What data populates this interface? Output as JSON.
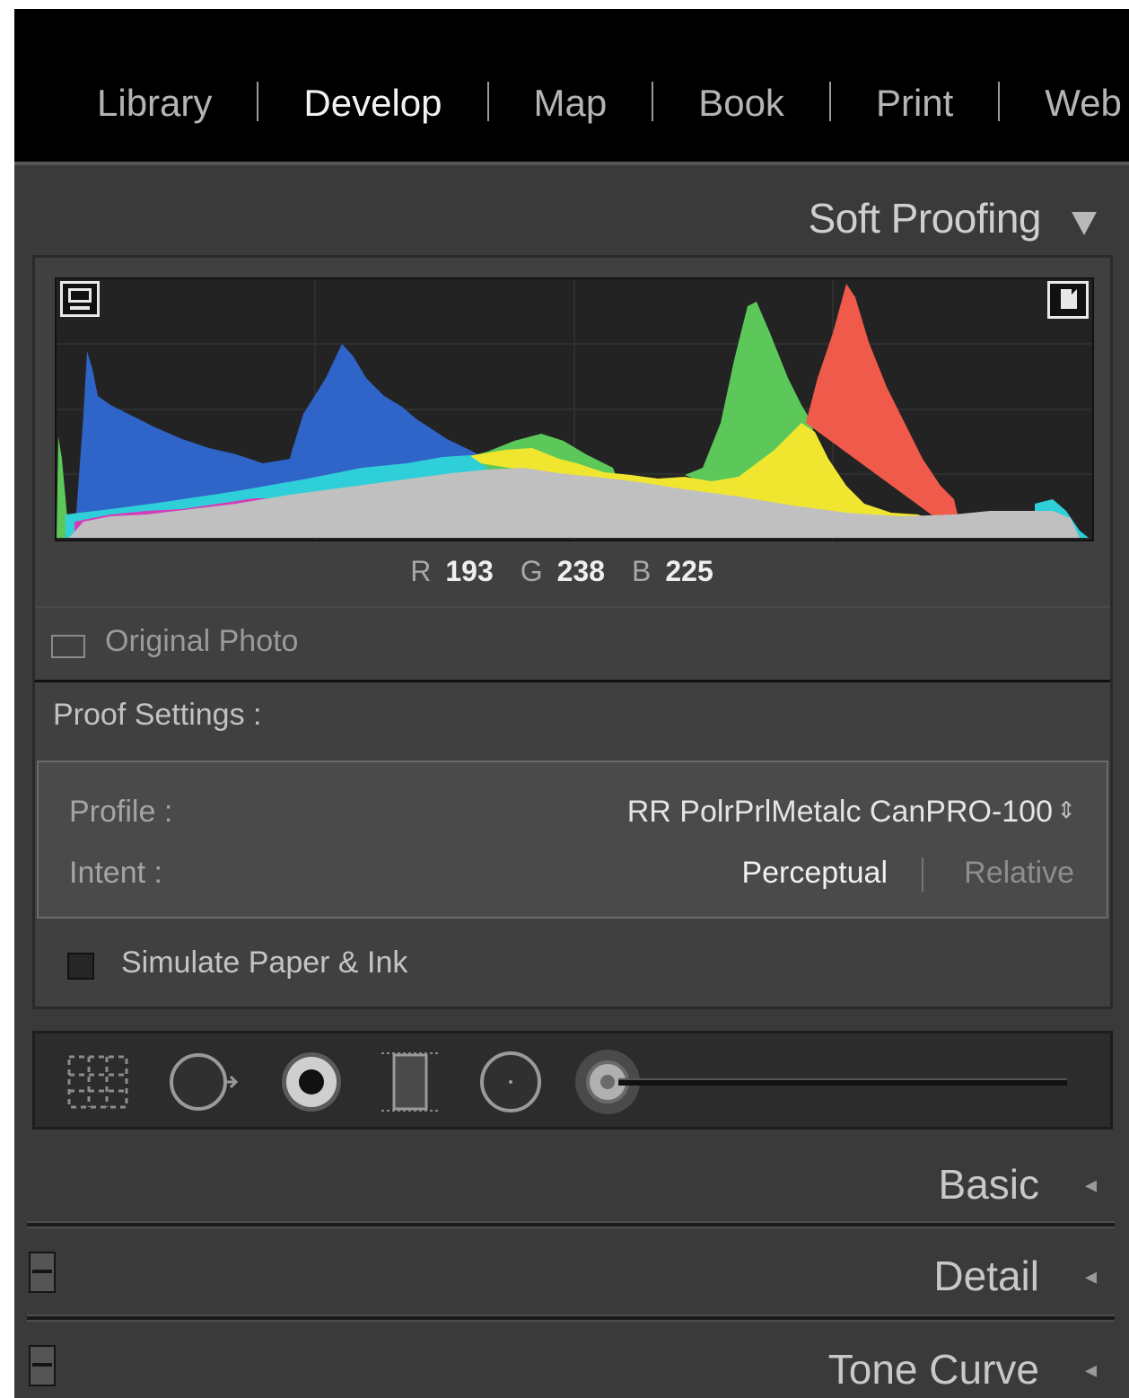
{
  "module_picker": {
    "items": [
      {
        "label": "Library",
        "active": false
      },
      {
        "label": "Develop",
        "active": true
      },
      {
        "label": "Map",
        "active": false
      },
      {
        "label": "Book",
        "active": false
      },
      {
        "label": "Print",
        "active": false
      },
      {
        "label": "Web",
        "active": false
      }
    ]
  },
  "soft_proofing": {
    "title": "Soft Proofing",
    "collapse_icon": "triangle-down-icon",
    "histogram": {
      "monitor_icon": "monitor-icon",
      "paper_icon": "paper-gamut-icon",
      "channels": [
        "red",
        "green",
        "blue",
        "cyan",
        "magenta",
        "yellow",
        "luminance"
      ]
    },
    "readout": {
      "r_label": "R",
      "r_value": "193",
      "g_label": "G",
      "g_value": "238",
      "b_label": "B",
      "b_value": "225"
    },
    "original_photo_label": "Original Photo",
    "proof_settings_label": "Proof Settings :",
    "profile_label": "Profile :",
    "profile_value": "RR PolrPrlMetalc CanPRO-100",
    "profile_spinner": "⇕",
    "intent_label": "Intent :",
    "intent_perceptual": "Perceptual",
    "intent_relative": "Relative",
    "intent_selected": "Perceptual",
    "simulate_label": "Simulate Paper & Ink",
    "simulate_checked": false
  },
  "tool_strip": {
    "tools": [
      "crop-overlay-icon",
      "spot-removal-icon",
      "red-eye-icon",
      "graduated-filter-icon",
      "radial-filter-icon",
      "adjustment-brush-icon"
    ]
  },
  "panels": {
    "basic": {
      "title": "Basic",
      "arrow": "◂"
    },
    "detail": {
      "title": "Detail",
      "arrow": "◂"
    },
    "tone_curve": {
      "title": "Tone Curve",
      "arrow": "◂"
    }
  },
  "colors": {
    "panel_bg": "#3a3a3a",
    "hist_red": "#f05a4a",
    "hist_green": "#5cc85a",
    "hist_blue": "#2f64c8",
    "hist_yellow": "#f0e630",
    "hist_cyan": "#2ecfd8",
    "hist_magenta": "#d53cb8",
    "hist_gray": "#c0c0c0"
  }
}
